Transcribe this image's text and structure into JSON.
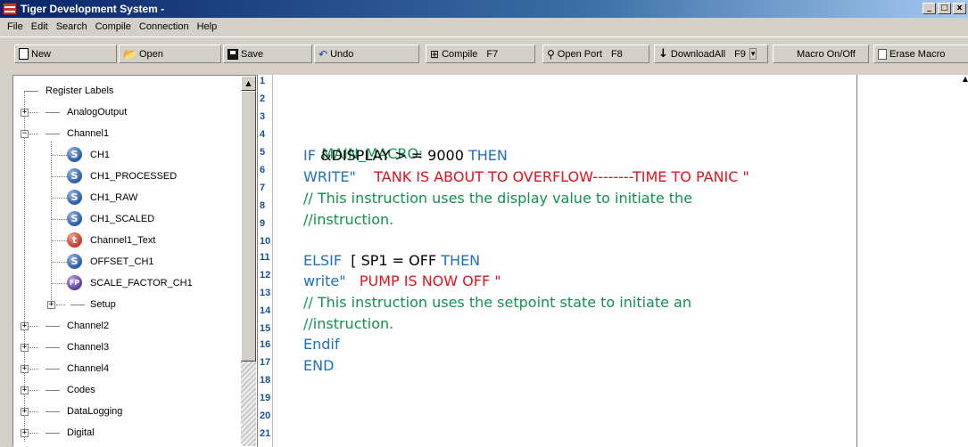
{
  "window": {
    "title": "Tiger Development System -",
    "controls": [
      "_",
      "□",
      "x"
    ]
  },
  "menu": [
    "File",
    "Edit",
    "Search",
    "Compile",
    "Connection",
    "Help"
  ],
  "toolbar": {
    "new": "New",
    "open": "Open",
    "save": "Save",
    "undo": "Undo",
    "compile": "Compile",
    "compile_key": "F7",
    "open_port": "Open Port",
    "open_port_key": "F8",
    "download_all": "DownloadAll",
    "download_key": "F9",
    "dropdown": "▾",
    "macro_toggle": "Macro On/Off",
    "erase_macro": "Erase Macro"
  },
  "tree": {
    "root": "Register Labels",
    "analog_output": "AnalogOutput",
    "channel1": "Channel1",
    "ch1_children": [
      {
        "label": "CH1",
        "icon": "S"
      },
      {
        "label": "CH1_PROCESSED",
        "icon": "S"
      },
      {
        "label": "CH1_RAW",
        "icon": "S"
      },
      {
        "label": "CH1_SCALED",
        "icon": "S"
      },
      {
        "label": "Channel1_Text",
        "icon": "t"
      },
      {
        "label": "OFFSET_CH1",
        "icon": "S"
      },
      {
        "label": "SCALE_FACTOR_CH1",
        "icon": "FP"
      }
    ],
    "setup": "Setup",
    "others": [
      "Channel2",
      "Channel3",
      "Channel4",
      "Codes",
      "DataLogging",
      "Digital"
    ]
  },
  "editor": {
    "line_numbers": [
      "1",
      "2",
      "3",
      "4",
      "5",
      "6",
      "7",
      "8",
      "9",
      "10",
      "11",
      "12",
      "13",
      "14",
      "15",
      "16",
      "17",
      "18",
      "19",
      "20",
      "21"
    ],
    "code": {
      "main_macro": "MAIN_MACRO:",
      "if_kw": "IF",
      "if_cond": " &DISPLAY > = 9000 ",
      "then_kw": "THEN",
      "write_kw": "WRITE\"",
      "write_msg": "    TANK IS ABOUT TO OVERFLOW--------TIME TO PANIC \"",
      "comment1": "// This instruction uses the display value to initiate the",
      "comment2": "//instruction.",
      "elsif_kw": "ELSIF",
      "elsif_cond": "  [ SP1 = OFF ",
      "then2_kw": "THEN",
      "write2_kw": "write\"",
      "write2_msg": "   PUMP IS NOW OFF \"",
      "comment3": "// This instruction uses the setpoint state to initiate an",
      "comment4": "//instruction.",
      "endif_kw": "Endif",
      "end_kw": "END"
    }
  }
}
